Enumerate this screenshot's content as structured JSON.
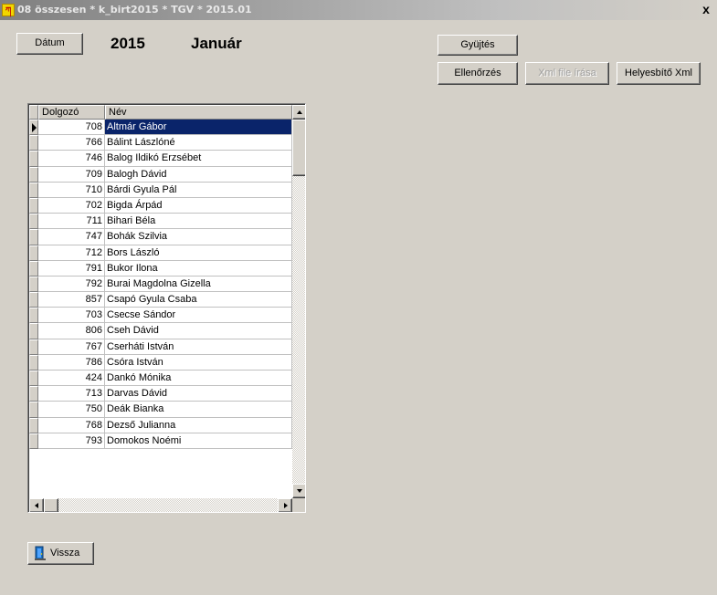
{
  "window": {
    "icon_label": "ཀ",
    "title": "08 összesen *  k_birt2015  * TGV * 2015.01",
    "close_label": "x"
  },
  "toolbar": {
    "datum_label": "Dátum",
    "year": "2015",
    "month": "Január",
    "gyujtes_label": "Gyüjtés",
    "ellenorzes_label": "Ellenőrzés",
    "xml_file_label": "Xml file írása",
    "helyesbito_label": "Helyesbítő Xml",
    "vissza_label": "Vissza"
  },
  "grid": {
    "columns": [
      "Dolgozó",
      "Név"
    ],
    "rows": [
      {
        "id": "708",
        "name": "Altmár Gábor"
      },
      {
        "id": "766",
        "name": "Bálint Lászlóné"
      },
      {
        "id": "746",
        "name": "Balog Ildikó Erzsébet"
      },
      {
        "id": "709",
        "name": "Balogh Dávid"
      },
      {
        "id": "710",
        "name": "Bárdi Gyula Pál"
      },
      {
        "id": "702",
        "name": "Bigda Árpád"
      },
      {
        "id": "711",
        "name": "Bihari Béla"
      },
      {
        "id": "747",
        "name": "Bohák Szilvia"
      },
      {
        "id": "712",
        "name": "Bors László"
      },
      {
        "id": "791",
        "name": "Bukor Ilona"
      },
      {
        "id": "792",
        "name": "Burai Magdolna Gizella"
      },
      {
        "id": "857",
        "name": "Csapó Gyula Csaba"
      },
      {
        "id": "703",
        "name": "Csecse Sándor"
      },
      {
        "id": "806",
        "name": "Cseh Dávid"
      },
      {
        "id": "767",
        "name": "Cserháti István"
      },
      {
        "id": "786",
        "name": "Csóra István"
      },
      {
        "id": "424",
        "name": "Dankó Mónika"
      },
      {
        "id": "713",
        "name": "Darvas Dávid"
      },
      {
        "id": "750",
        "name": "Deák Bianka"
      },
      {
        "id": "768",
        "name": "Dezső Julianna"
      },
      {
        "id": "793",
        "name": "Domokos Noémi"
      }
    ]
  },
  "colors": {
    "selection": "#0a246a",
    "face": "#d4d0c8",
    "icon_bg": "#f2d600"
  }
}
